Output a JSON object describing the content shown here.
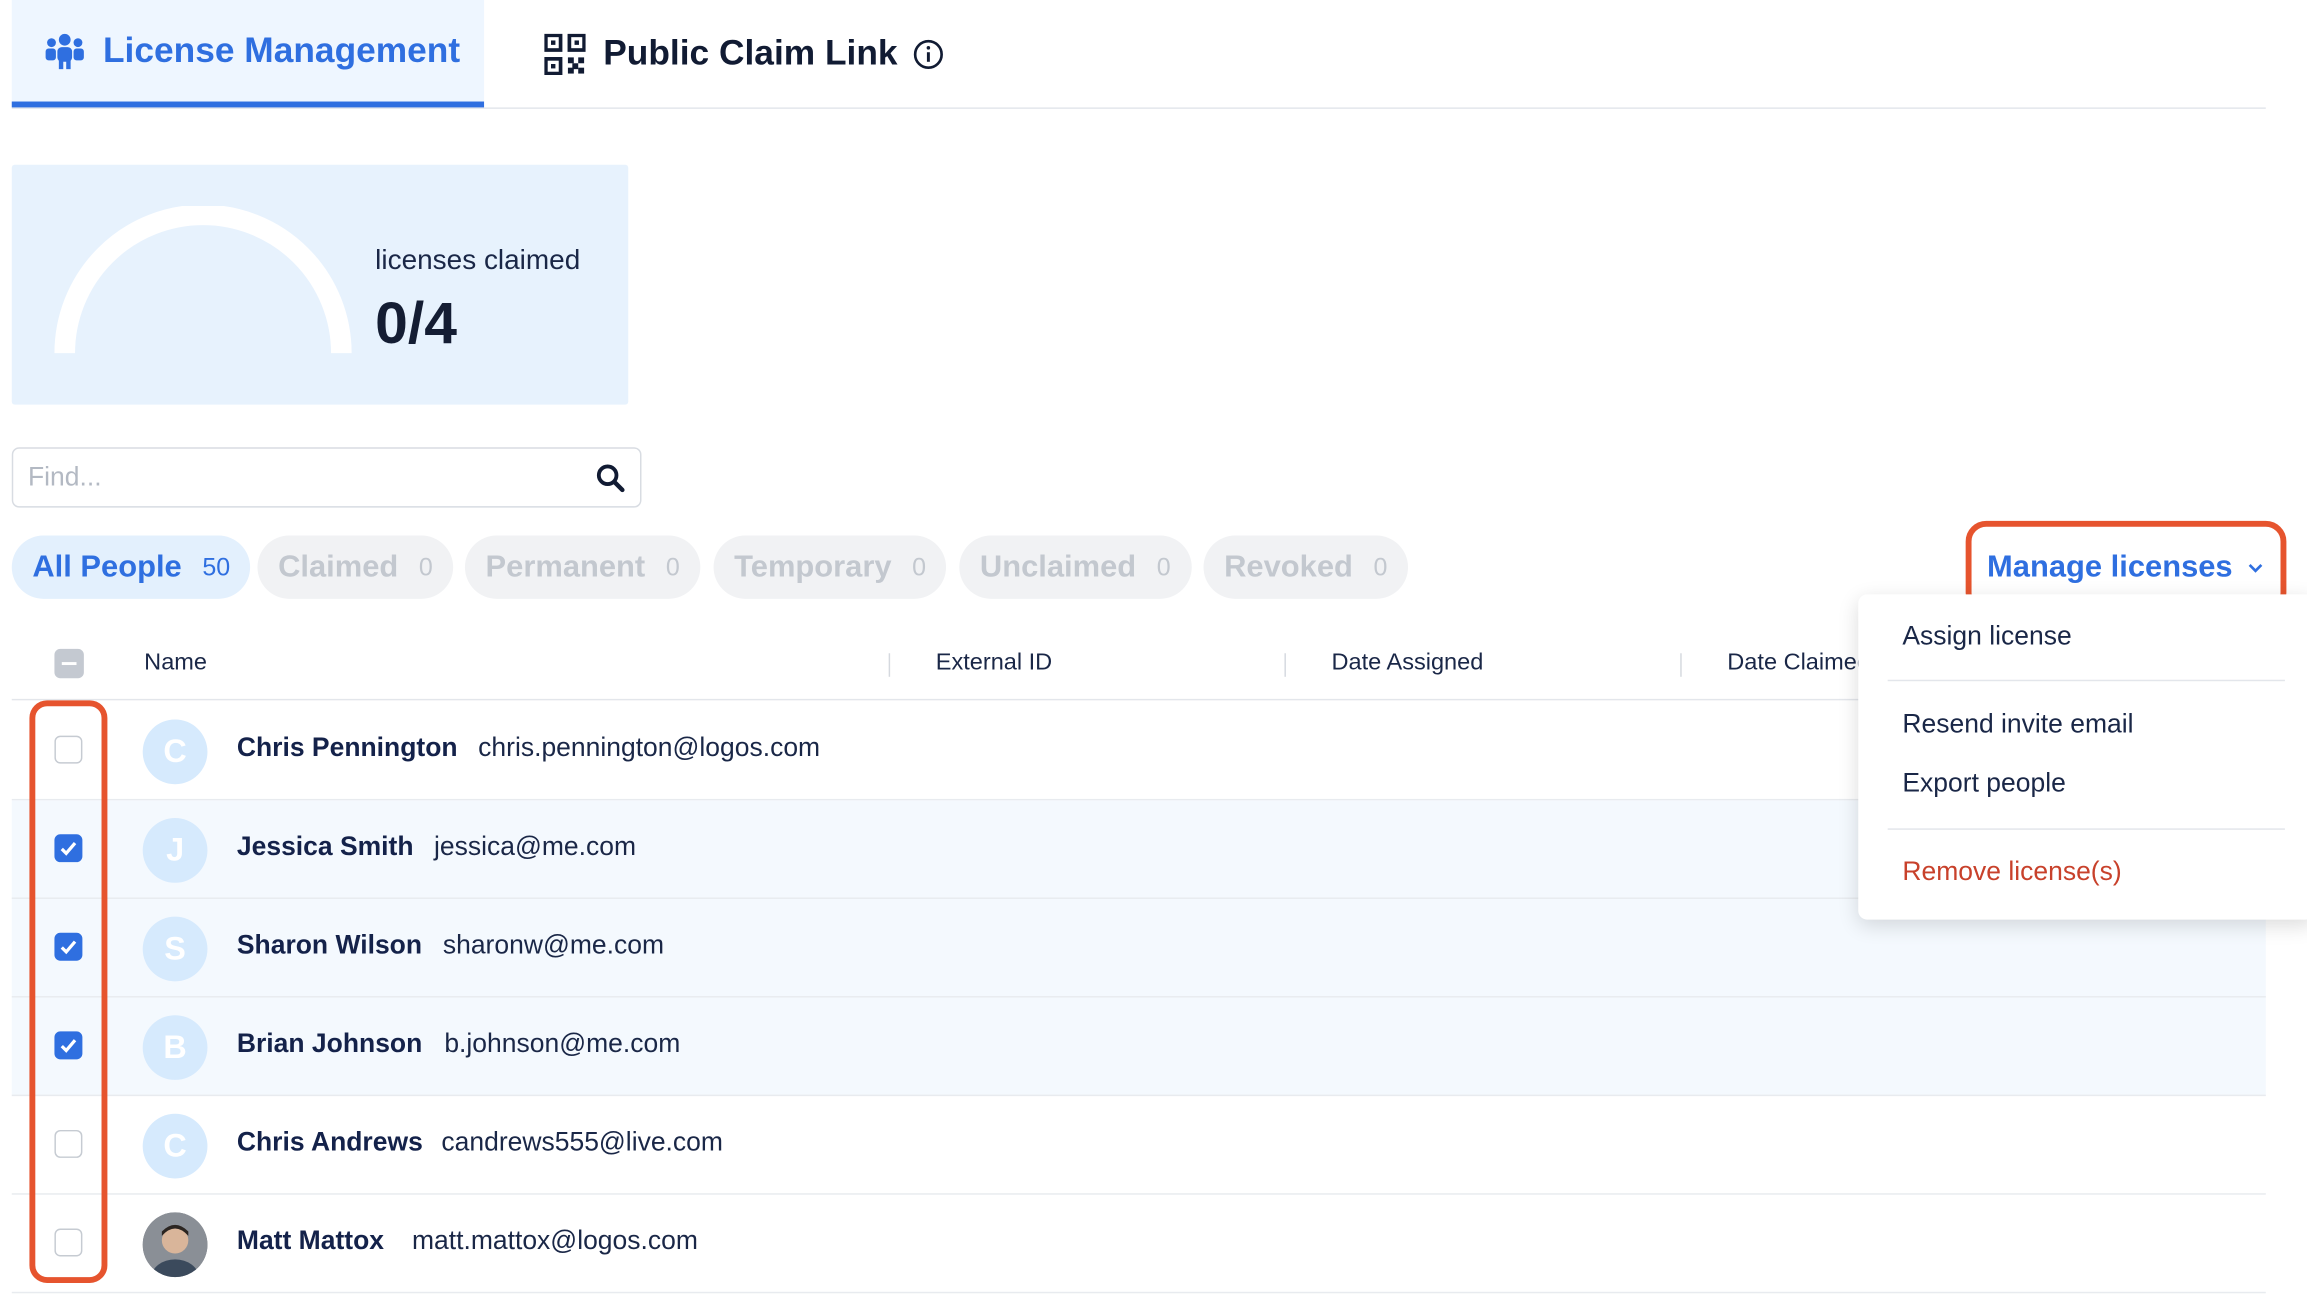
{
  "tabs": {
    "license": "License Management",
    "public": "Public Claim Link"
  },
  "summary": {
    "label": "licenses claimed",
    "value": "0/4",
    "claimed_fraction": 0
  },
  "search": {
    "placeholder": "Find..."
  },
  "filters": [
    {
      "label": "All People",
      "count": "50"
    },
    {
      "label": "Claimed",
      "count": "0"
    },
    {
      "label": "Permanent",
      "count": "0"
    },
    {
      "label": "Temporary",
      "count": "0"
    },
    {
      "label": "Unclaimed",
      "count": "0"
    },
    {
      "label": "Revoked",
      "count": "0"
    }
  ],
  "manage": {
    "label": "Manage licenses"
  },
  "columns": {
    "name": "Name",
    "external_id": "External ID",
    "date_assigned": "Date Assigned",
    "date_claimed": "Date Claimed"
  },
  "rows": [
    {
      "initial": "C",
      "name": "Chris Pennington",
      "email": "chris.pennington@logos.com",
      "checked": false
    },
    {
      "initial": "J",
      "name": "Jessica Smith",
      "email": "jessica@me.com",
      "checked": true
    },
    {
      "initial": "S",
      "name": "Sharon Wilson",
      "email": "sharonw@me.com",
      "checked": true
    },
    {
      "initial": "B",
      "name": "Brian Johnson",
      "email": "b.johnson@me.com",
      "checked": true
    },
    {
      "initial": "C",
      "name": "Chris Andrews",
      "email": "candrews555@live.com",
      "checked": false
    },
    {
      "initial": "",
      "name": "Matt Mattox",
      "email": "matt.mattox@logos.com",
      "checked": false
    }
  ],
  "menu": {
    "assign": "Assign license",
    "resend": "Resend invite email",
    "export": "Export people",
    "remove": "Remove license(s)"
  },
  "colors": {
    "accent": "#2f6fe0",
    "highlight": "#e6542e",
    "danger": "#c8412b"
  }
}
